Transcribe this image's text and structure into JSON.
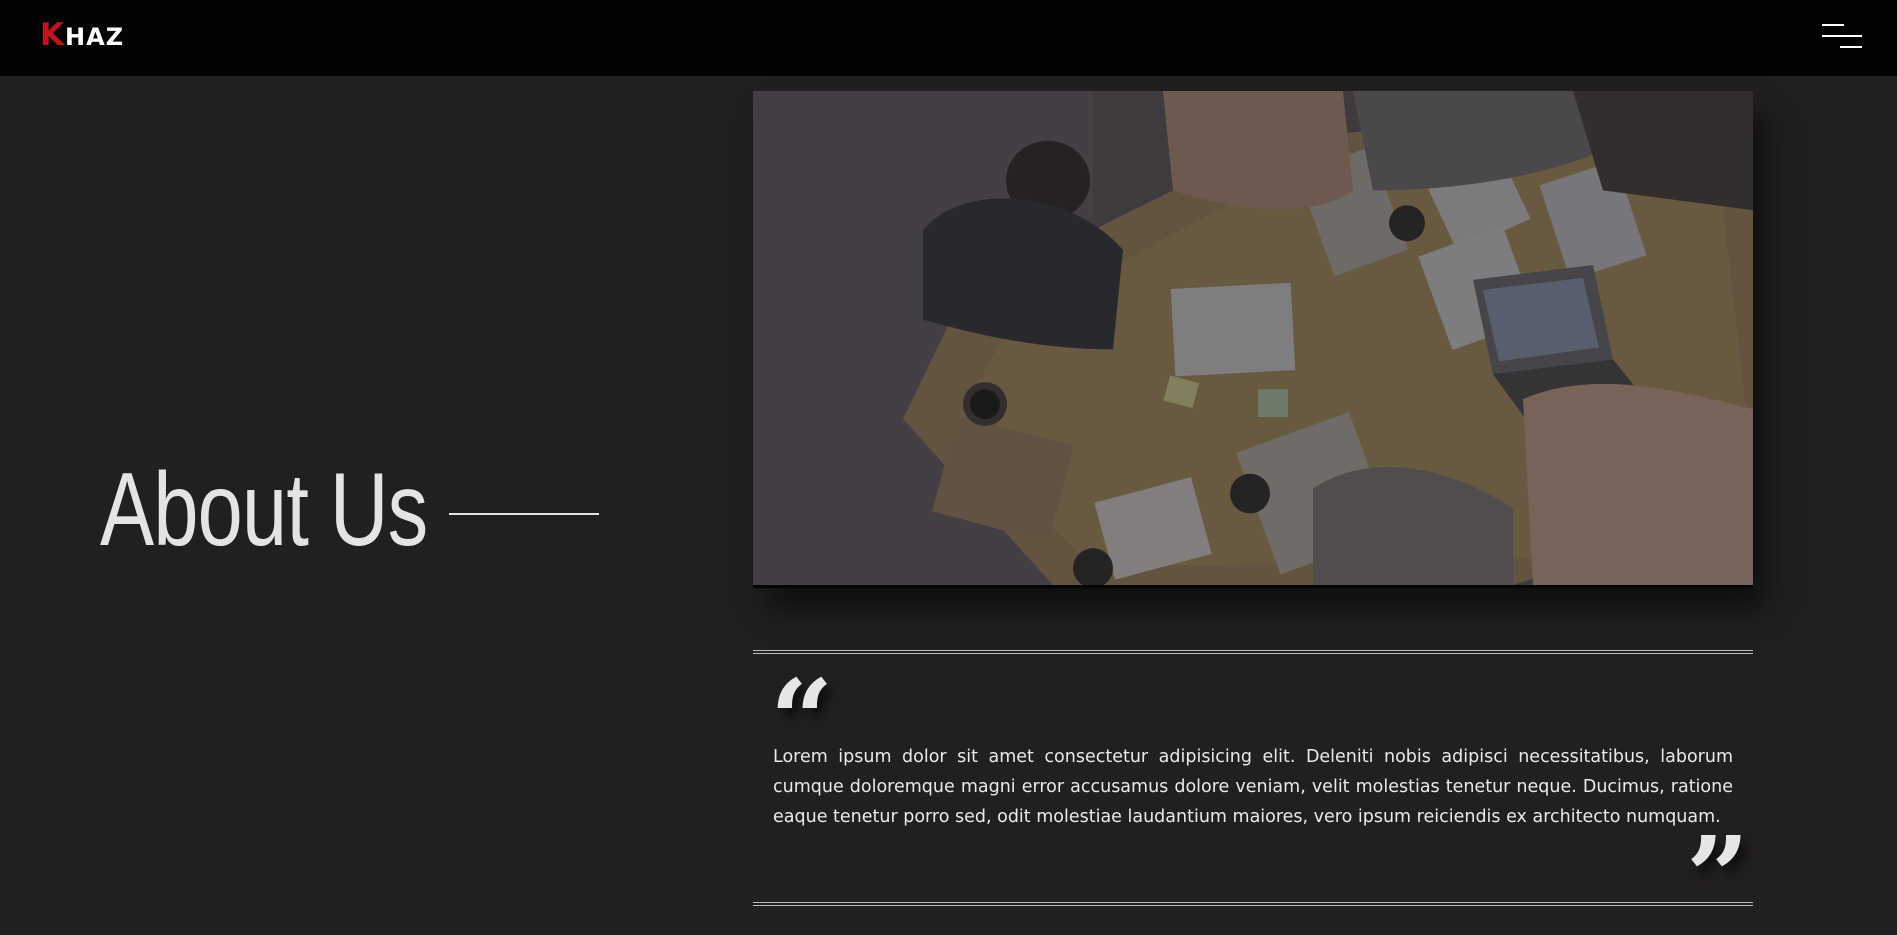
{
  "header": {
    "logo_initial": "K",
    "logo_rest": "HAZ",
    "menu_icon": "hamburger-menu-icon"
  },
  "about": {
    "title": "About Us"
  },
  "hero_image": {
    "description_icon": "team-meeting-photo"
  },
  "testimonial": {
    "open_quote": "“",
    "close_quote": "”",
    "text": "Lorem ipsum dolor sit amet consectetur adipisicing elit. Deleniti nobis adipisci necessitatibus, laborum cumque doloremque magni error accusamus dolore veniam, velit molestias tenetur neque. Ducimus, ratione eaque tenetur porro sed, odit molestiae laudantium maiores, vero ipsum reiciendis ex architecto numquam."
  },
  "colors": {
    "background": "#221f21",
    "navbar": "#030303",
    "logo_accent": "#c1121f",
    "text": "#ececec"
  }
}
